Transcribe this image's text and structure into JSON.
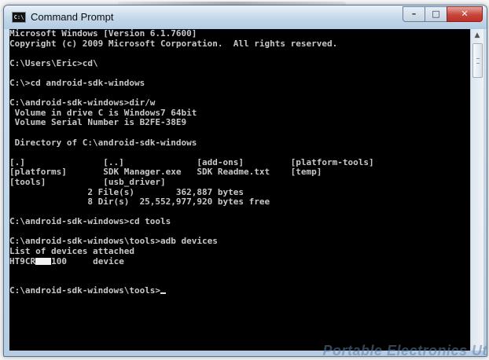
{
  "window": {
    "title": "Command Prompt",
    "icon_label": "C:\\",
    "buttons": {
      "minimize": "–",
      "maximize": "□",
      "close": "✕"
    }
  },
  "console": {
    "lines": [
      "Microsoft Windows [Version 6.1.7600]",
      "Copyright (c) 2009 Microsoft Corporation.  All rights reserved.",
      "",
      "C:\\Users\\Eric>cd\\",
      "",
      "C:\\>cd android-sdk-windows",
      "",
      "C:\\android-sdk-windows>dir/w",
      " Volume in drive C is Windows7 64bit",
      " Volume Serial Number is B2FE-38E9",
      "",
      " Directory of C:\\android-sdk-windows",
      "",
      "[.]               [..]              [add-ons]         [platform-tools]",
      "[platforms]       SDK Manager.exe   SDK Readme.txt    [temp]",
      "[tools]           [usb_driver]",
      "               2 File(s)        362,887 bytes",
      "               8 Dir(s)  25,552,977,920 bytes free",
      "",
      "C:\\android-sdk-windows>cd tools",
      "",
      "C:\\android-sdk-windows\\tools>adb devices",
      "List of devices attached"
    ],
    "device_line": {
      "prefix": "HT9CR",
      "suffix": "100     device"
    },
    "after_lines": [
      "",
      ""
    ],
    "prompt": "C:\\android-sdk-windows\\tools>"
  },
  "scrollbar": {
    "up_arrow": "▲"
  },
  "watermark": "Portable Electronics Ut"
}
